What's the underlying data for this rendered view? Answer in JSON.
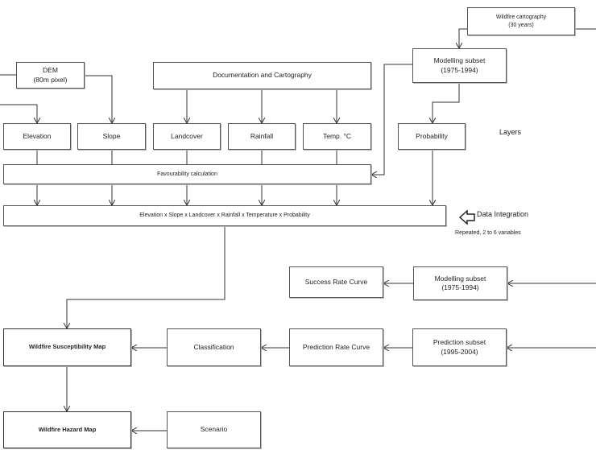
{
  "boxes": {
    "wildfire_cartography": "Wildfire cartography\n(30 years)",
    "modelling_subset_top": "Modelling subset\n(1975-1994)",
    "dem": "DEM\n(80m pixel)",
    "documentation": "Documentation and Cartography",
    "elevation": "Elevation",
    "slope": "Slope",
    "landcover": "Landcover",
    "rainfall": "Rainfall",
    "temperature": "Temp.  °C",
    "probability": "Probability",
    "favourability": "Favourability  calculation",
    "integration": "Elevation x Slope x Landcover x Rainfall x Temperature x Probability",
    "success_rate_curve": "Success Rate Curve",
    "modelling_subset_bottom": "Modelling subset\n(1975-1994)",
    "susceptibility_map": "Wildfire Susceptibility Map",
    "classification": "Classification",
    "prediction_rate_curve": "Prediction Rate Curve",
    "prediction_subset": "Prediction subset\n(1995-2004)",
    "hazard_map": "Wildfire Hazard Map",
    "scenario": "Scenario"
  },
  "labels": {
    "layers": "Layers",
    "data_integration": "Data Integration",
    "repeated": "Repeated, 2 to 6 variables"
  },
  "icons": {
    "data_integration_arrow": "hollow-left-arrow-icon"
  }
}
